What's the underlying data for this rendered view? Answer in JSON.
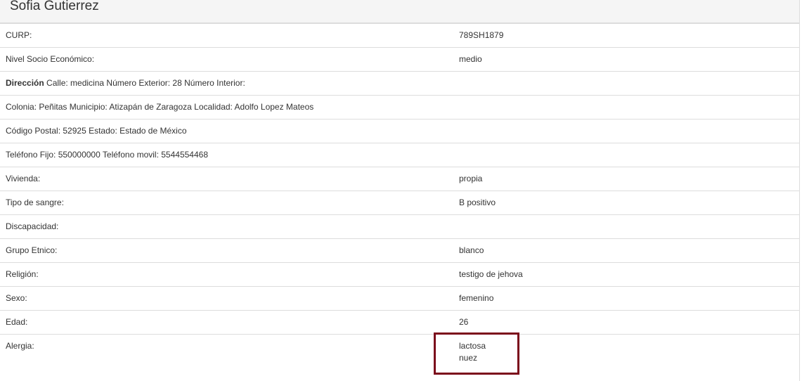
{
  "patient": {
    "name": "Sofia Gutierrez"
  },
  "rows": {
    "curp": {
      "label": "CURP:",
      "value": "789SH1879"
    },
    "nse": {
      "label": "Nivel Socio Económico:",
      "value": "medio"
    },
    "direccion": {
      "label": "Dirección",
      "text": "Calle: medicina Número Exterior: 28 Número Interior:"
    },
    "colonia": {
      "text": "Colonia: Peñitas Municipio: Atizapán de Zaragoza Localidad: Adolfo Lopez Mateos"
    },
    "postal": {
      "text": "Código Postal: 52925 Estado: Estado de México"
    },
    "telefono": {
      "text": "Teléfono Fijo: 550000000 Teléfono movil: 5544554468"
    },
    "vivienda": {
      "label": "Vivienda:",
      "value": "propia"
    },
    "sangre": {
      "label": "Tipo de sangre:",
      "value": "B positivo"
    },
    "discapacidad": {
      "label": "Discapacidad:",
      "value": ""
    },
    "etnico": {
      "label": "Grupo Etnico:",
      "value": "blanco"
    },
    "religion": {
      "label": "Religión:",
      "value": "testigo de jehova"
    },
    "sexo": {
      "label": "Sexo:",
      "value": "femenino"
    },
    "edad": {
      "label": "Edad:",
      "value": "26"
    },
    "alergia": {
      "label": "Alergia:",
      "values": [
        "lactosa",
        "nuez"
      ]
    }
  },
  "colors": {
    "highlight_border": "#7b0a1b",
    "heading_bg": "#f5f5f5",
    "row_border": "#dddddd"
  }
}
